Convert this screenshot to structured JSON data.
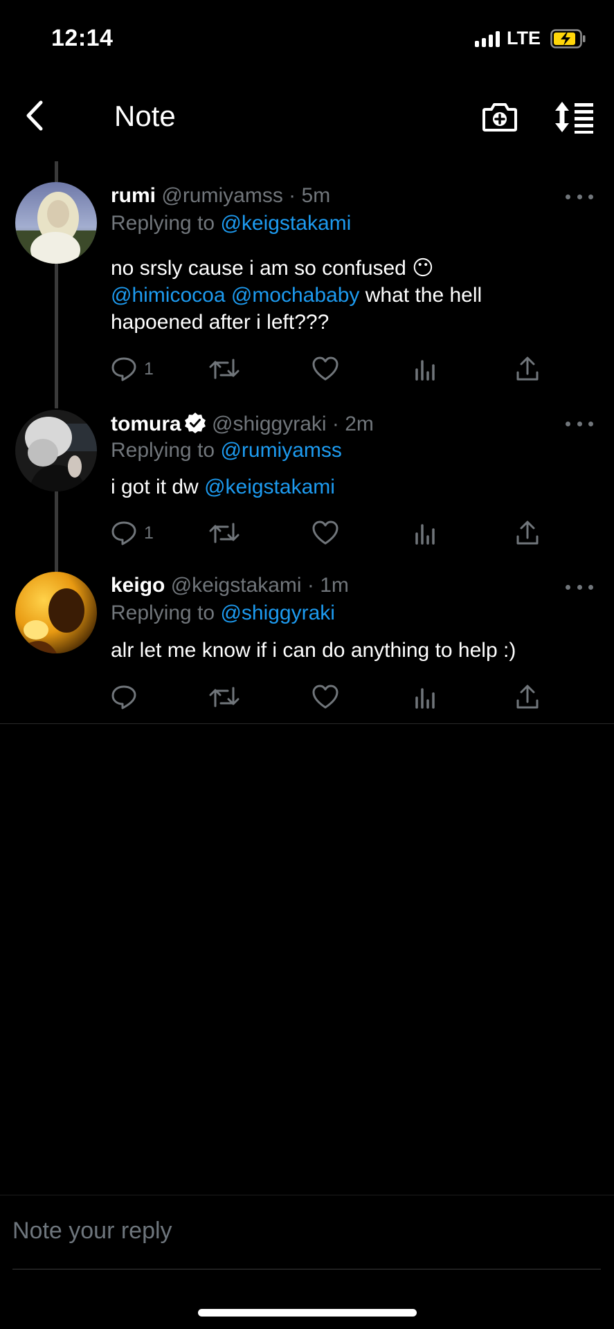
{
  "status_bar": {
    "time": "12:14",
    "network": "LTE",
    "battery_icon": "battery-charging-icon",
    "battery_color": "#ffd60a"
  },
  "header": {
    "title": "Note",
    "back_icon": "chevron-left-icon",
    "camera_icon": "camera-plus-icon",
    "sort_icon": "sort-thread-icon"
  },
  "colors": {
    "background": "#000000",
    "accent": "#1d9bf0",
    "muted": "#71767b"
  },
  "tweets": [
    {
      "name": "rumi",
      "handle": "@rumiyamss",
      "separator": "·",
      "time": "5m",
      "replying_prefix": "Replying to",
      "replying_to": "@keigstakami",
      "body_line1": "no srsly cause i am so confused 😶",
      "mention_a": "@himicocoa",
      "mention_b": "@mochababy",
      "body_line2_tail": " what the hell",
      "body_line3": "hapoened after i left???",
      "reply_count": "1",
      "verified": false
    },
    {
      "name": "tomura",
      "handle": "@shiggyraki",
      "separator": "·",
      "time": "2m",
      "replying_prefix": "Replying to",
      "replying_to": "@rumiyamss",
      "body_text": "i got it dw ",
      "body_mention": "@keigstakami",
      "reply_count": "1",
      "verified": true
    },
    {
      "name": "keigo",
      "handle": "@keigstakami",
      "separator": "·",
      "time": "1m",
      "replying_prefix": "Replying to",
      "replying_to": "@shiggyraki",
      "body_text": "alr let me know if i can do anything to help :)",
      "reply_count": "",
      "verified": false
    }
  ],
  "composer": {
    "placeholder": "Note your reply"
  }
}
